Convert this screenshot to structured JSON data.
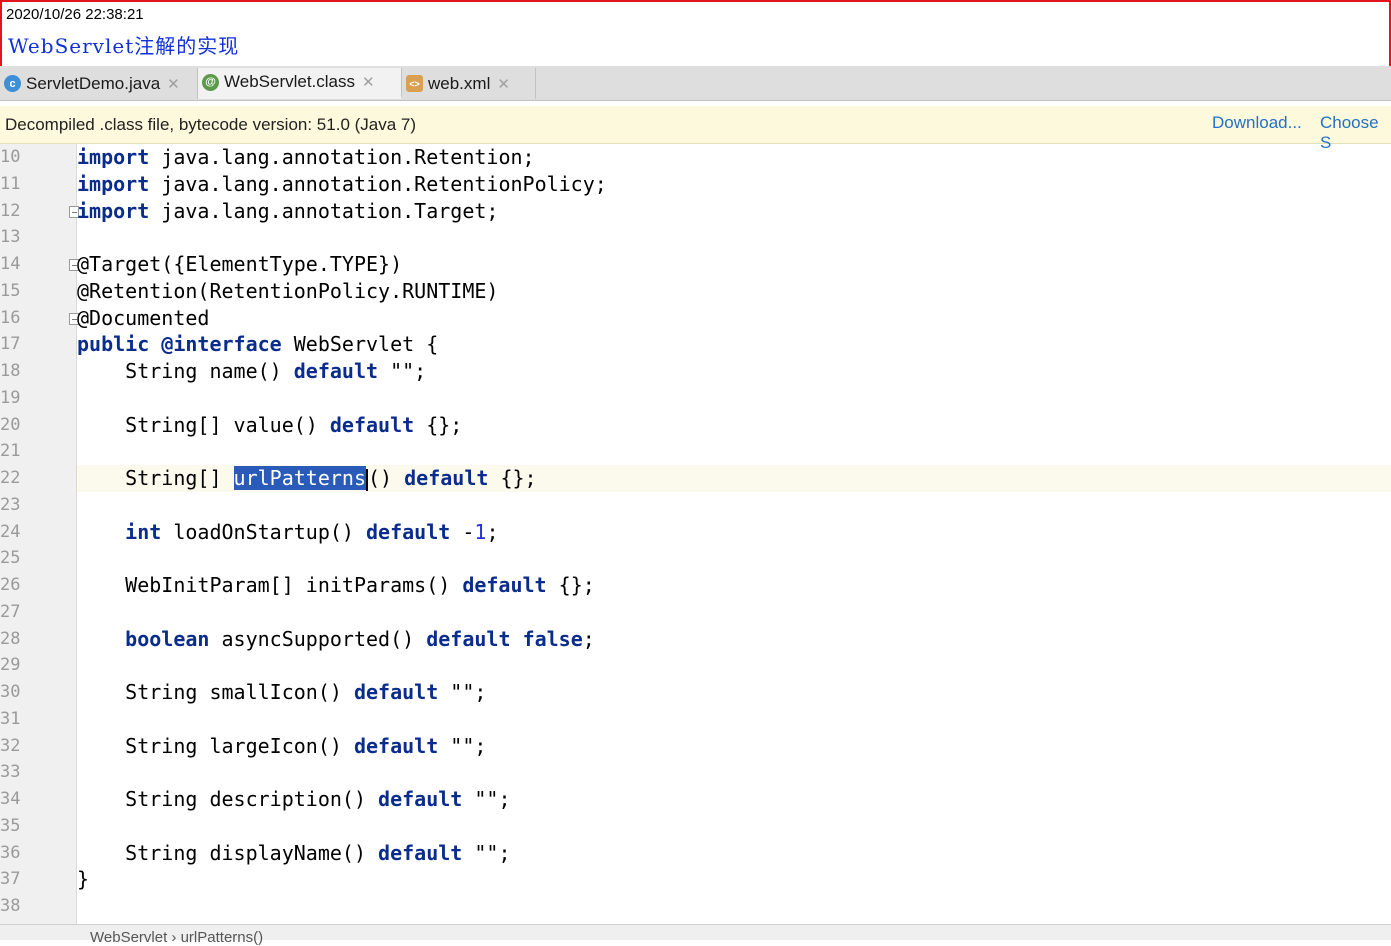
{
  "annotation": {
    "timestamp": "2020/10/26 22:38:21",
    "title": "WebServlet注解的实现"
  },
  "tabs": [
    {
      "label": "ServletDemo.java",
      "icon": "class-c-icon",
      "icon_char": "c",
      "icon_color": "#3e8fd6",
      "active": false
    },
    {
      "label": "WebServlet.class",
      "icon": "annotation-icon",
      "icon_char": "@",
      "icon_color": "#5a9a4a",
      "active": true
    },
    {
      "label": "web.xml",
      "icon": "xml-file-icon",
      "icon_char": "<>",
      "icon_color": "#d8a050",
      "active": false
    }
  ],
  "banner": {
    "message": "Decompiled .class file, bytecode version: 51.0 (Java 7)",
    "download_label": "Download...",
    "choose_label": "Choose S"
  },
  "line_numbers": [
    "10",
    "11",
    "12",
    "13",
    "14",
    "15",
    "16",
    "17",
    "18",
    "19",
    "20",
    "21",
    "22",
    "23",
    "24",
    "25",
    "26",
    "27",
    "28",
    "29",
    "30",
    "31",
    "32",
    "33",
    "34",
    "35",
    "36",
    "37",
    "38"
  ],
  "code_lines": [
    [
      {
        "t": "import",
        "c": "kw"
      },
      {
        "t": " java.lang.annotation.Retention;"
      }
    ],
    [
      {
        "t": "import",
        "c": "kw"
      },
      {
        "t": " java.lang.annotation.RetentionPolicy;"
      }
    ],
    [
      {
        "t": "import",
        "c": "kw"
      },
      {
        "t": " java.lang.annotation.Target;"
      }
    ],
    [],
    [
      {
        "t": "@Target({ElementType.TYPE})"
      }
    ],
    [
      {
        "t": "@Retention(RetentionPolicy.RUNTIME)"
      }
    ],
    [
      {
        "t": "@Documented"
      }
    ],
    [
      {
        "t": "public",
        "c": "kw"
      },
      {
        "t": " "
      },
      {
        "t": "@interface",
        "c": "kw"
      },
      {
        "t": " WebServlet {"
      }
    ],
    [
      {
        "t": "    String name() "
      },
      {
        "t": "default",
        "c": "kw"
      },
      {
        "t": " \"\";"
      }
    ],
    [],
    [
      {
        "t": "    String[] value() "
      },
      {
        "t": "default",
        "c": "kw"
      },
      {
        "t": " {};"
      }
    ],
    [],
    [
      {
        "t": "    String[] "
      },
      {
        "t": "urlPatterns",
        "c": "sel"
      },
      {
        "t": "",
        "c": "cursor"
      },
      {
        "t": "() "
      },
      {
        "t": "default",
        "c": "kw"
      },
      {
        "t": " {};"
      }
    ],
    [],
    [
      {
        "t": "    "
      },
      {
        "t": "int",
        "c": "kw"
      },
      {
        "t": " loadOnStartup() "
      },
      {
        "t": "default",
        "c": "kw"
      },
      {
        "t": " -"
      },
      {
        "t": "1",
        "c": "num"
      },
      {
        "t": ";"
      }
    ],
    [],
    [
      {
        "t": "    WebInitParam[] initParams() "
      },
      {
        "t": "default",
        "c": "kw"
      },
      {
        "t": " {};"
      }
    ],
    [],
    [
      {
        "t": "    "
      },
      {
        "t": "boolean",
        "c": "kw"
      },
      {
        "t": " asyncSupported() "
      },
      {
        "t": "default",
        "c": "kw"
      },
      {
        "t": " "
      },
      {
        "t": "false",
        "c": "kw"
      },
      {
        "t": ";"
      }
    ],
    [],
    [
      {
        "t": "    String smallIcon() "
      },
      {
        "t": "default",
        "c": "kw"
      },
      {
        "t": " \"\";"
      }
    ],
    [],
    [
      {
        "t": "    String largeIcon() "
      },
      {
        "t": "default",
        "c": "kw"
      },
      {
        "t": " \"\";"
      }
    ],
    [],
    [
      {
        "t": "    String description() "
      },
      {
        "t": "default",
        "c": "kw"
      },
      {
        "t": " \"\";"
      }
    ],
    [],
    [
      {
        "t": "    String displayName() "
      },
      {
        "t": "default",
        "c": "kw"
      },
      {
        "t": " \"\";"
      }
    ],
    [
      {
        "t": "}"
      }
    ],
    []
  ],
  "caret_line": "22",
  "fold_markers": [
    "12",
    "14",
    "16"
  ],
  "status_text": "WebServlet › urlPatterns()"
}
